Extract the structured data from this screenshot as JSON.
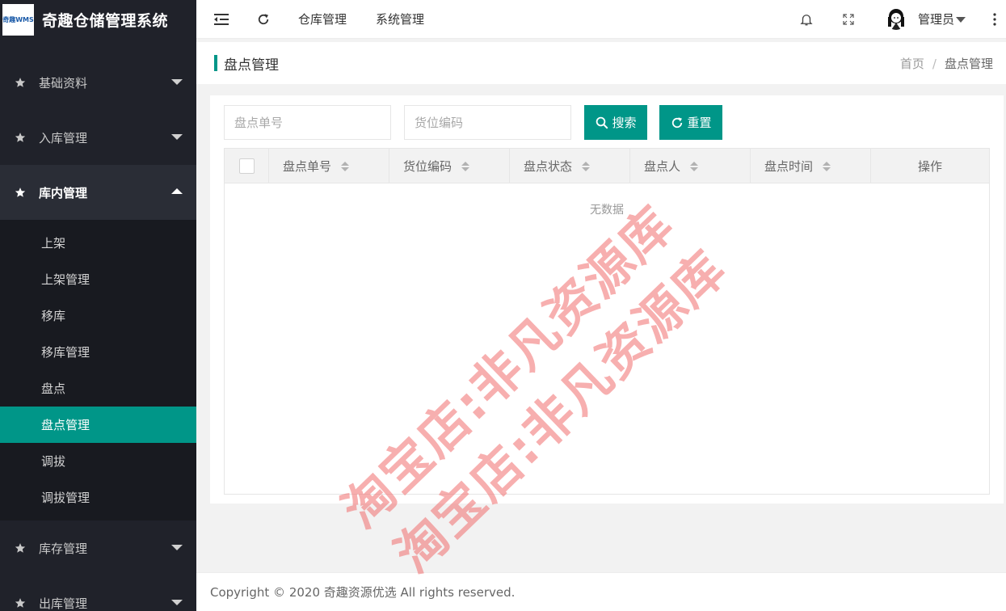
{
  "app": {
    "logo_text": "奇趣WMS",
    "title": "奇趣仓储管理系统"
  },
  "header": {
    "nav": [
      "仓库管理",
      "系统管理"
    ],
    "user": "管理员"
  },
  "sidebar": {
    "groups": [
      {
        "label": "基础资料"
      },
      {
        "label": "入库管理"
      },
      {
        "label": "库内管理",
        "items": [
          "上架",
          "上架管理",
          "移库",
          "移库管理",
          "盘点",
          "盘点管理",
          "调拔",
          "调拔管理"
        ]
      },
      {
        "label": "库存管理"
      },
      {
        "label": "出库管理"
      }
    ]
  },
  "page": {
    "title": "盘点管理",
    "breadcrumb": {
      "home": "首页",
      "sep": "/",
      "current": "盘点管理"
    }
  },
  "search": {
    "order_placeholder": "盘点单号",
    "location_placeholder": "货位编码",
    "search_label": "搜索",
    "reset_label": "重置"
  },
  "table": {
    "columns": [
      "盘点单号",
      "货位编码",
      "盘点状态",
      "盘点人",
      "盘点时间",
      "操作"
    ],
    "empty_text": "无数据"
  },
  "footer": {
    "copyright": "Copyright © 2020 奇趣资源优选 All rights reserved."
  },
  "watermark": {
    "text": "淘宝店:非凡资源库"
  },
  "colors": {
    "accent": "#009688",
    "sidebar_bg": "#20222a",
    "submenu_bg": "#181a20"
  }
}
